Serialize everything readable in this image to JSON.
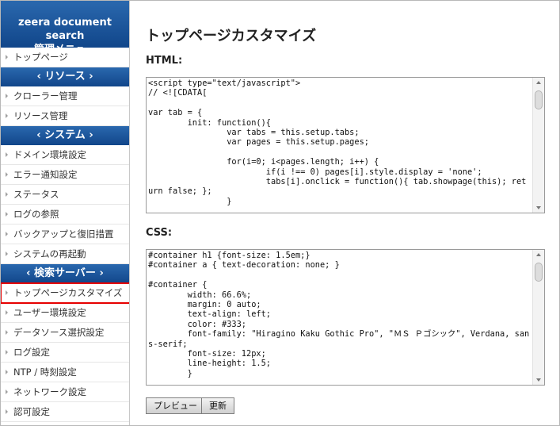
{
  "sidebar": {
    "head_line1": "zeera document search",
    "head_line2": "管理メニュー",
    "item_top": "トップページ",
    "section_resource": "‹ リソース ›",
    "resource_items": [
      "クローラー管理",
      "リソース管理"
    ],
    "section_system": "‹ システム ›",
    "system_items": [
      "ドメイン環境設定",
      "エラー通知設定",
      "ステータス",
      "ログの参照",
      "バックアップと復旧措置",
      "システムの再起動"
    ],
    "section_search": "‹ 検索サーバー ›",
    "search_items": [
      "トップページカスタマイズ",
      "ユーザー環境設定",
      "データソース選択設定",
      "ログ設定",
      "NTP / 時刻設定",
      "ネットワーク設定",
      "認可設定"
    ]
  },
  "main": {
    "title": "トップページカスタマイズ",
    "html_label": "HTML:",
    "css_label": "CSS:",
    "html_code": "<script type=\"text/javascript\">\n// <![CDATA[\n\nvar tab = {\n        init: function(){\n                var tabs = this.setup.tabs;\n                var pages = this.setup.pages;\n\n                for(i=0; i<pages.length; i++) {\n                        if(i !== 0) pages[i].style.display = 'none';\n                        tabs[i].onclick = function(){ tab.showpage(this); return false; };\n                }",
    "css_code": "#container h1 {font-size: 1.5em;}\n#container a { text-decoration: none; }\n\n#container {\n        width: 66.6%;\n        margin: 0 auto;\n        text-align: left;\n        color: #333;\n        font-family: \"Hiragino Kaku Gothic Pro\", \"ＭＳ Ｐゴシック\", Verdana, sans-serif;\n        font-size: 12px;\n        line-height: 1.5;\n        }",
    "preview_button": "プレビュー",
    "update_button": "更新"
  },
  "colors": {
    "header_blue": "#1c559c",
    "highlight_red": "#e60000"
  }
}
